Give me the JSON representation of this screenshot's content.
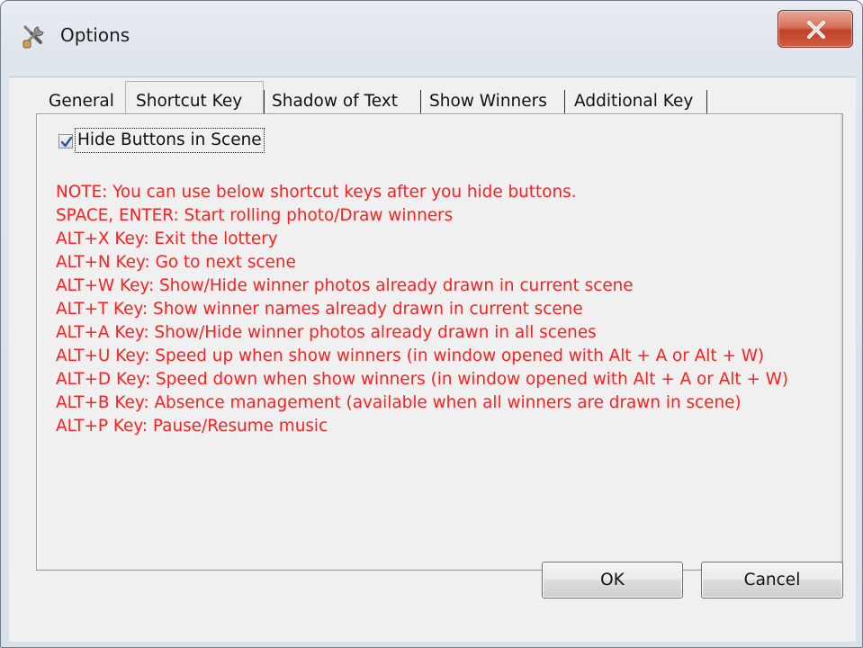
{
  "window": {
    "title": "Options",
    "close_glyph": "X"
  },
  "icons": {
    "title_icon": "wrench-screwdriver-icon",
    "close_icon": "close-icon",
    "check_icon": "checkmark-icon"
  },
  "tabs": [
    {
      "label": "General",
      "active": false
    },
    {
      "label": "Shortcut Key",
      "active": true
    },
    {
      "label": "Shadow of Text",
      "active": false
    },
    {
      "label": "Show Winners",
      "active": false
    },
    {
      "label": "Additional Key",
      "active": false
    }
  ],
  "shortcut_tab": {
    "hide_buttons_checkbox": {
      "label": "Hide Buttons in Scene",
      "checked": true
    },
    "notes": [
      "NOTE: You can use below shortcut keys after you hide buttons.",
      "SPACE, ENTER: Start rolling photo/Draw winners",
      "ALT+X Key: Exit the lottery",
      "ALT+N Key: Go to next scene",
      "ALT+W Key: Show/Hide winner photos already drawn in current scene",
      "ALT+T Key: Show winner names already drawn in current scene",
      "ALT+A Key: Show/Hide winner photos already drawn in all scenes",
      "ALT+U Key: Speed up when show winners (in window opened with Alt + A or Alt + W)",
      "ALT+D Key: Speed down when show winners (in window opened with Alt + A or Alt + W)",
      "ALT+B Key: Absence management (available when all winners are drawn in scene)",
      "ALT+P Key: Pause/Resume music"
    ]
  },
  "buttons": {
    "ok": "OK",
    "cancel": "Cancel"
  },
  "colors": {
    "note_text": "#ff1e1e",
    "client_bg": "#f0f0f0",
    "close_button": "#c9452d"
  }
}
